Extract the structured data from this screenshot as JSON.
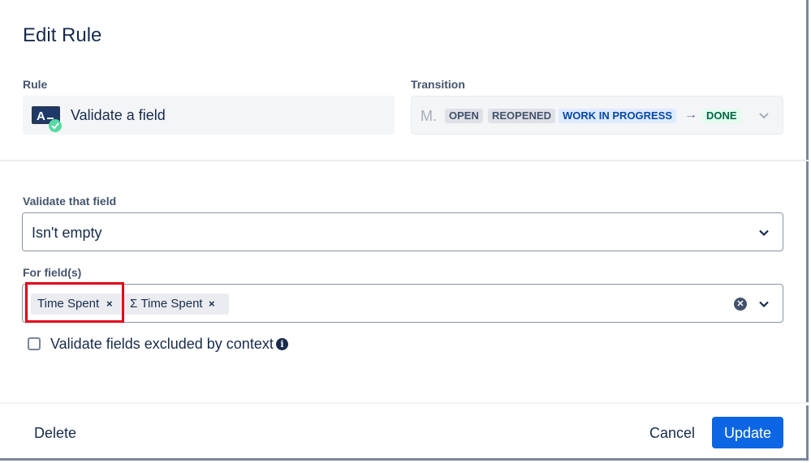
{
  "dialog": {
    "title": "Edit Rule"
  },
  "rule": {
    "label": "Rule",
    "value": "Validate a field",
    "icon": "validate-field-icon"
  },
  "transition": {
    "label": "Transition",
    "prefix": "M.",
    "from": [
      "OPEN",
      "REOPENED",
      "WORK IN PROGRESS"
    ],
    "arrow": "→",
    "to": "DONE",
    "colors": {
      "grey": "#dfe1e6",
      "blue": "#deebff",
      "green": "#e3fcef"
    }
  },
  "validate": {
    "label": "Validate that field",
    "value": "Isn't empty"
  },
  "fields": {
    "label": "For field(s)",
    "tags": [
      "Time Spent",
      "Σ Time Spent"
    ],
    "remove_glyph": "×"
  },
  "checkbox": {
    "label": "Validate fields excluded by context",
    "checked": false,
    "info_glyph": "i"
  },
  "footer": {
    "delete_label": "Delete",
    "cancel_label": "Cancel",
    "update_label": "Update",
    "accent": "#0c66e4"
  },
  "highlight_color": "#e2001a"
}
